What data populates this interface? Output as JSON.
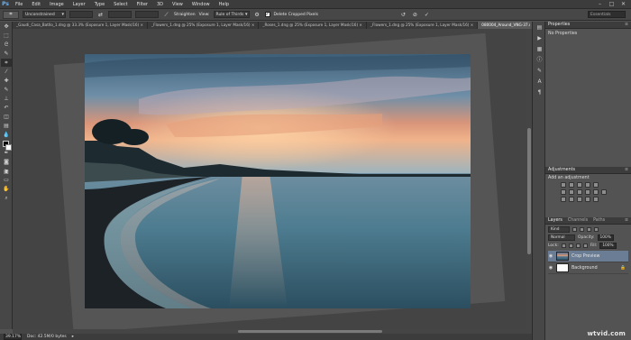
{
  "app": {
    "logo": "Ps"
  },
  "menu": [
    "File",
    "Edit",
    "Image",
    "Layer",
    "Type",
    "Select",
    "Filter",
    "3D",
    "View",
    "Window",
    "Help"
  ],
  "window_controls": {
    "minimize": "–",
    "maximize": "□",
    "close": "✕"
  },
  "options": {
    "ratio": "Unconstrained",
    "straighten": "Straighten",
    "view_label": "View:",
    "view_value": "Rule of Thirds",
    "delete_cropped": "Delete Cropped Pixels",
    "workspace": "Essentials"
  },
  "tabs": [
    "_Gaudi_Casa_Batllo_1.dng @ 33.3% (Exposure 1, Layer Mask/16) ×",
    "_Flowers_1.dng @ 25% (Exposure 1, Layer Mask/16) ×",
    "_Roses_1.dng @ 25% (Exposure 1, Layer Mask/16) ×",
    "_Flowers_1.dng @ 25% (Exposure 1, Layer Mask/16) ×",
    "080004_Around_VNG-37.dng @ 39.2% (Crop Preview, RGB/8) ×"
  ],
  "active_tab_index": 4,
  "status": {
    "zoom": "39.17%",
    "doc": "Doc: 42.5M/0 bytes"
  },
  "panels": {
    "properties": {
      "title": "Properties",
      "body": "No Properties"
    },
    "adjustments": {
      "title": "Adjustments",
      "subtitle": "Add an adjustment"
    },
    "layers": {
      "tabs": [
        "Layers",
        "Channels",
        "Paths"
      ],
      "kind": "Kind",
      "blend": "Normal",
      "opacity_label": "Opacity:",
      "opacity": "100%",
      "lock_label": "Lock:",
      "fill_label": "Fill:",
      "fill": "100%",
      "items": [
        {
          "name": "Crop Preview",
          "selected": true,
          "thumb": "photo"
        },
        {
          "name": "Background",
          "selected": false,
          "thumb": "white"
        }
      ]
    }
  },
  "watermark": "wtvid.com"
}
